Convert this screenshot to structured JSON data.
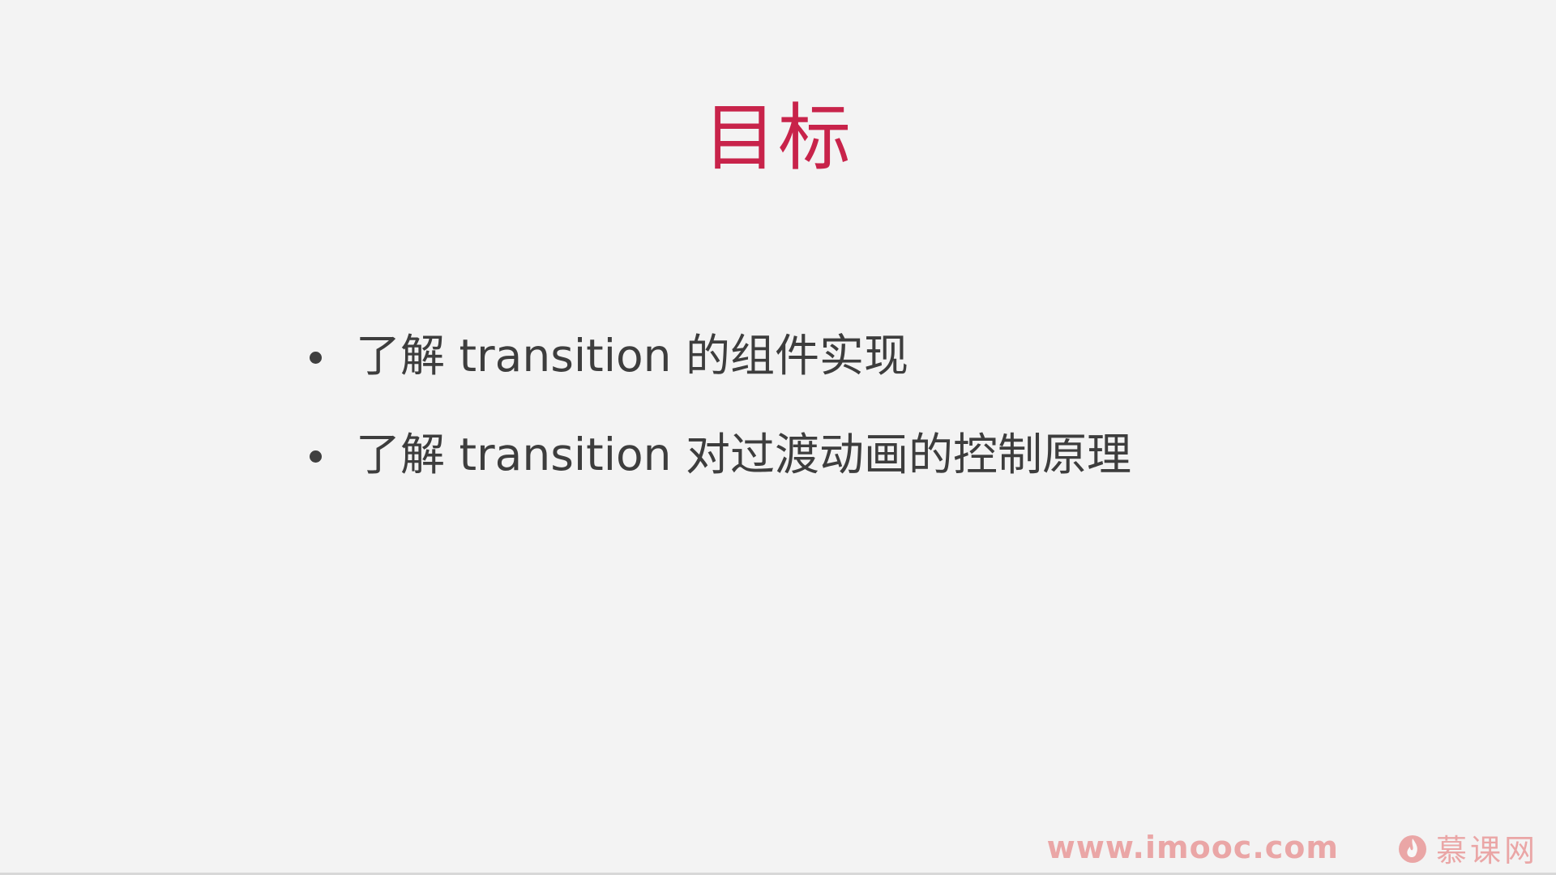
{
  "slide": {
    "title": "目标",
    "bullets": [
      "了解 transition 的组件实现",
      "了解 transition 对过渡动画的控制原理"
    ]
  },
  "watermark": {
    "url": "www.imooc.com",
    "brand": "慕课网",
    "logo_icon": "flame-logo-icon",
    "color": "#e04a4a"
  },
  "colors": {
    "title": "#c8234a",
    "text": "#3d3d3d",
    "background": "#f3f3f3"
  }
}
